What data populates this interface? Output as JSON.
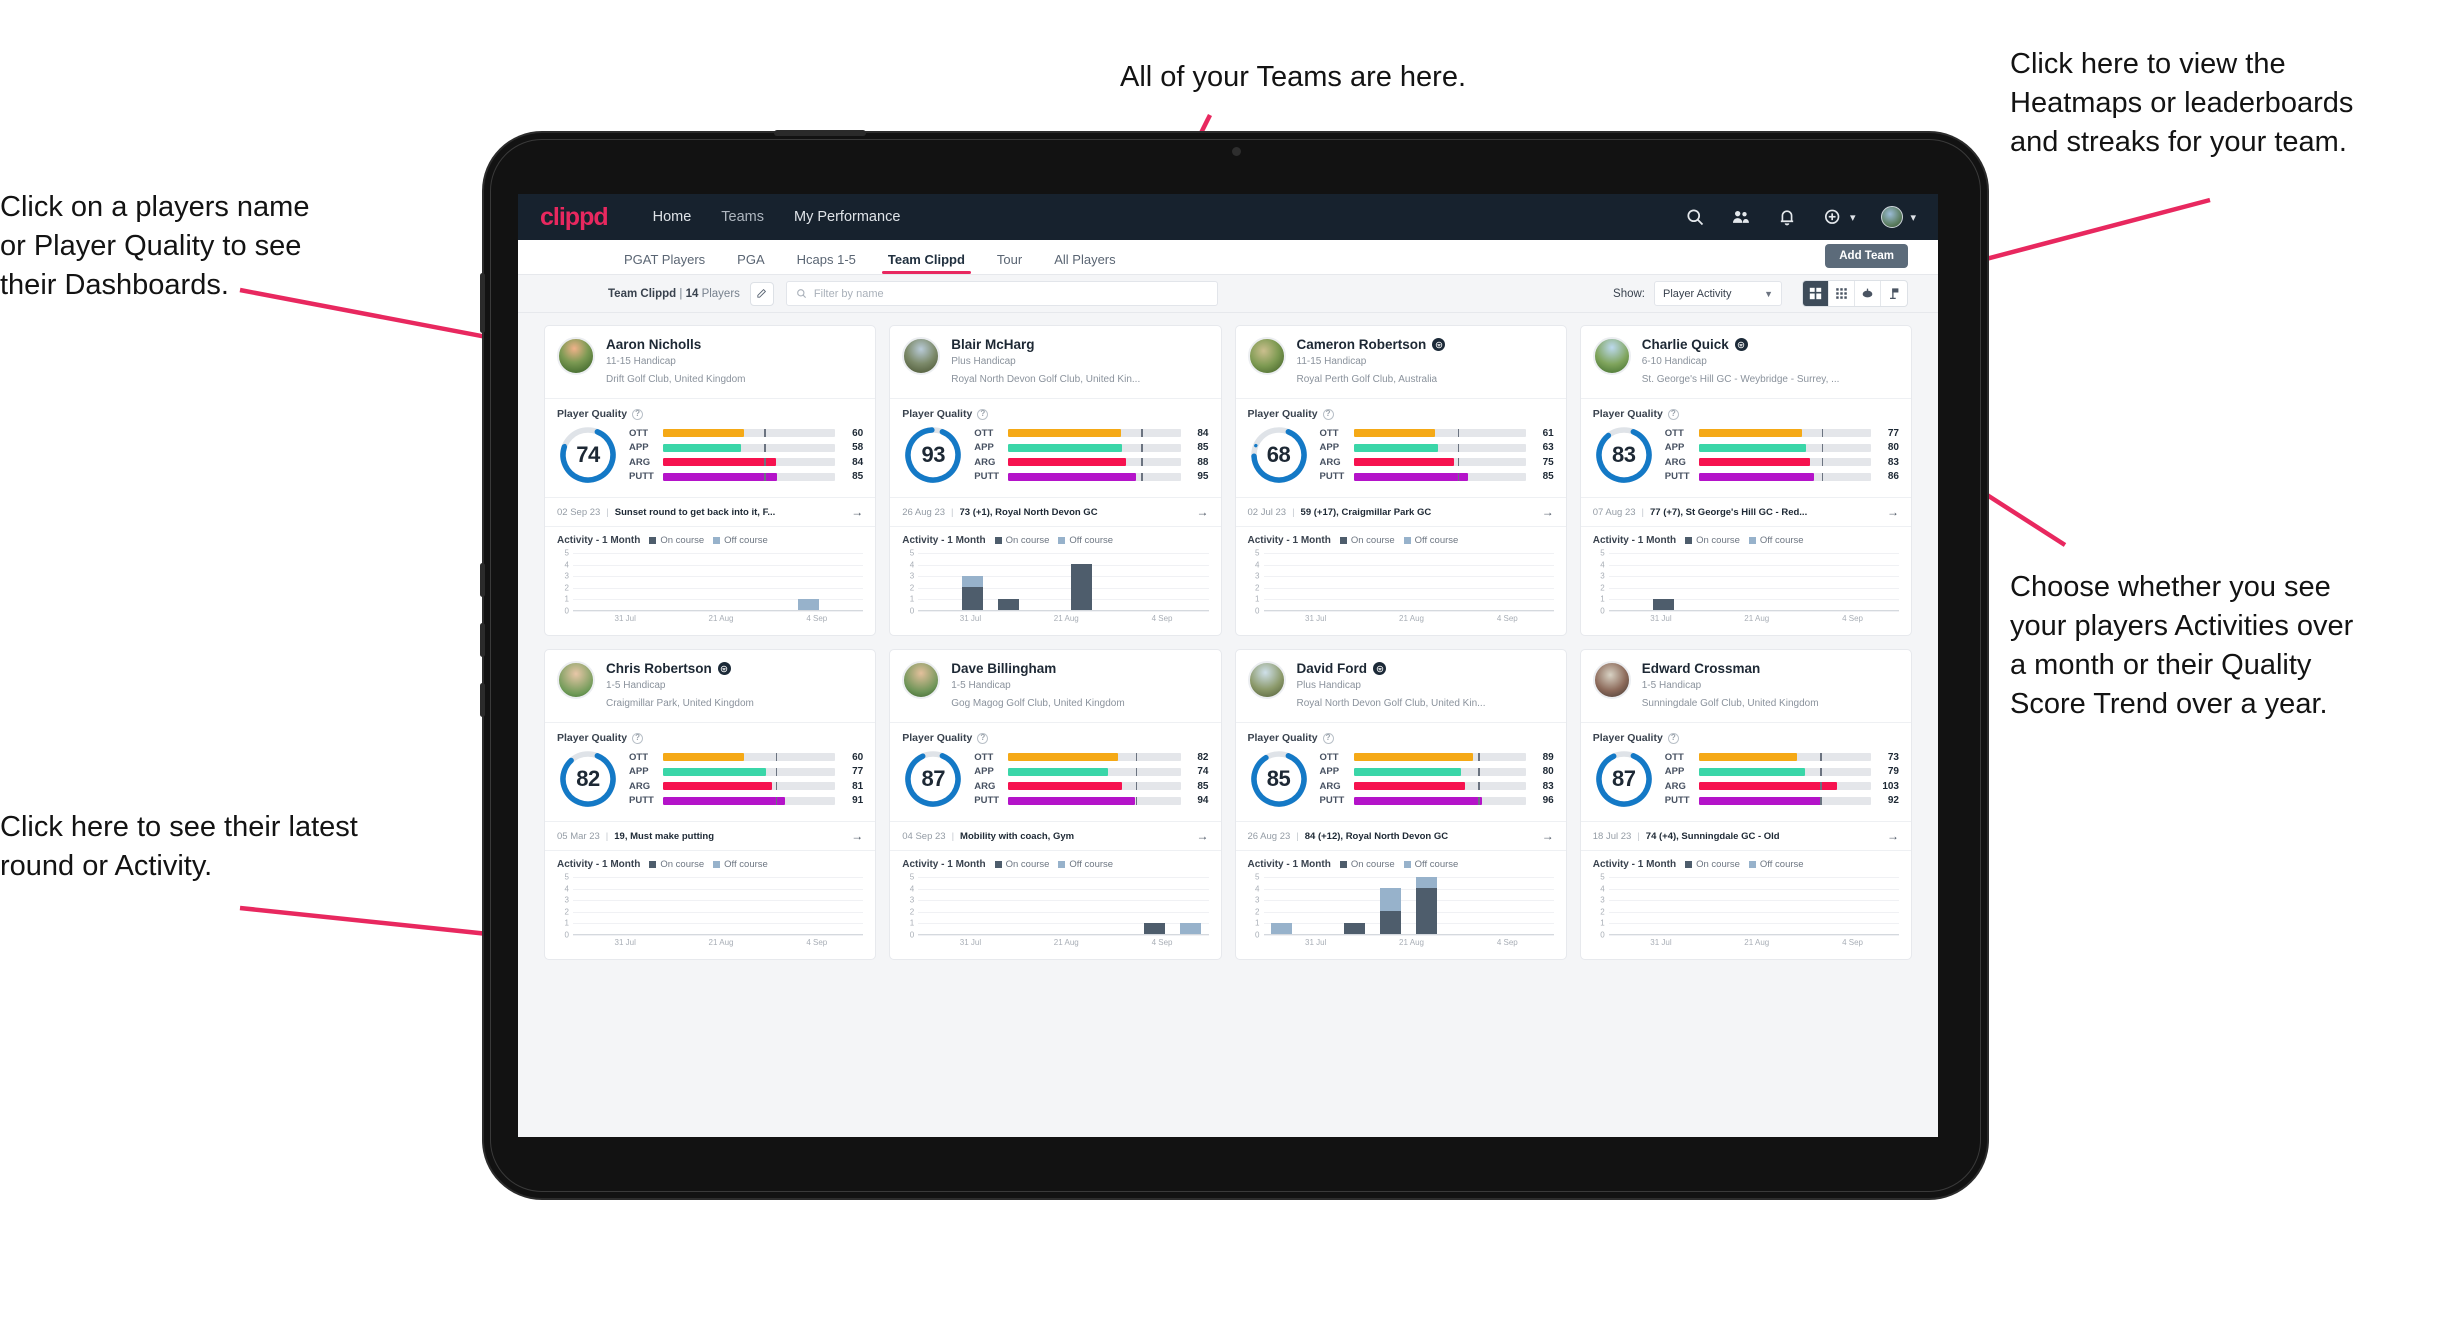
{
  "annotations": [
    {
      "id": "teams-note",
      "text": "All of your Teams are here."
    },
    {
      "id": "heatmaps-note",
      "text": "Click here to view the\nHeatmaps or leaderboards\nand streaks for your team."
    },
    {
      "id": "players-note",
      "text": "Click on a players name\nor Player Quality to see\ntheir Dashboards."
    },
    {
      "id": "activity-choice-note",
      "text": "Choose whether you see\nyour players Activities over\na month or their Quality\nScore Trend over a year."
    },
    {
      "id": "latest-round-note",
      "text": "Click here to see their latest\nround or Activity."
    }
  ],
  "navbar": {
    "logo": "clippd",
    "links": [
      {
        "label": "Home",
        "active": true
      },
      {
        "label": "Teams",
        "active": false
      },
      {
        "label": "My Performance",
        "active": false
      }
    ],
    "icons": [
      "search-icon",
      "people-icon",
      "bell-icon",
      "plus-circle-icon",
      "avatar"
    ]
  },
  "tabs": [
    {
      "label": "PGAT Players",
      "active": false
    },
    {
      "label": "PGA",
      "active": false
    },
    {
      "label": "Hcaps 1-5",
      "active": false
    },
    {
      "label": "Team Clippd",
      "active": true
    },
    {
      "label": "Tour",
      "active": false
    },
    {
      "label": "All Players",
      "active": false
    }
  ],
  "add_team_label": "Add Team",
  "filterbar": {
    "team_name": "Team Clippd",
    "separator": "|",
    "player_count": "14",
    "players_word": "Players",
    "edit_icon": "pencil-icon",
    "search_placeholder": "Filter by name",
    "show_label": "Show:",
    "show_value": "Player Activity",
    "view_buttons": [
      {
        "icon": "grid-cards-icon",
        "active": true
      },
      {
        "icon": "grid-dots-icon",
        "active": false
      },
      {
        "icon": "heatmap-icon",
        "active": false
      },
      {
        "icon": "flag-icon",
        "active": false
      }
    ]
  },
  "card_labels": {
    "player_quality": "Player Quality",
    "activity_title": "Activity - 1 Month",
    "legend_on": "On course",
    "legend_off": "Off course",
    "metrics": [
      "OTT",
      "APP",
      "ARG",
      "PUTT"
    ],
    "x_ticks": [
      "31 Jul",
      "21 Aug",
      "4 Sep"
    ],
    "y_ticks": [
      "5",
      "4",
      "3",
      "2",
      "1",
      "0"
    ],
    "arrow": "→"
  },
  "colors": {
    "brand_pink": "#e8285f",
    "navy": "#17222e",
    "ott": "#f5a916",
    "app": "#3ad6a8",
    "arg": "#f6124f",
    "putt": "#b413c9",
    "ring": "#1479c6",
    "on_course": "#4e5d6c",
    "off_course": "#97b2cb"
  },
  "players": [
    {
      "name": "Aaron Nicholls",
      "verified": false,
      "handicap": "11-15 Handicap",
      "club": "Drift Golf Club, United Kingdom",
      "quality": 74,
      "avatar_css": "radial-gradient(circle at 45% 28%, #f0b28a 0%, #7c9a53 45%, #2f5a22 100%)",
      "metrics": [
        {
          "key": "OTT",
          "value": 60,
          "color": "#f5a916",
          "tick": 70
        },
        {
          "key": "APP",
          "value": 58,
          "color": "#3ad6a8",
          "tick": 70
        },
        {
          "key": "ARG",
          "value": 84,
          "color": "#f6124f",
          "tick": 70
        },
        {
          "key": "PUTT",
          "value": 85,
          "color": "#b413c9",
          "tick": 70
        }
      ],
      "latest": {
        "date": "02 Sep 23",
        "text": "Sunset round to get back into it, F..."
      },
      "chart_data": {
        "type": "bar",
        "title": "Activity - 1 Month",
        "categories": [
          "31 Jul",
          "21 Aug",
          "4 Sep"
        ],
        "ylim": [
          0,
          5
        ],
        "series": [
          {
            "name": "On course",
            "values": [
              0,
              0,
              0,
              0,
              0,
              0,
              0,
              0
            ]
          },
          {
            "name": "Off course",
            "values": [
              0,
              0,
              0,
              0,
              0,
              0,
              1,
              0
            ]
          }
        ]
      }
    },
    {
      "name": "Blair McHarg",
      "verified": false,
      "handicap": "Plus Handicap",
      "club": "Royal North Devon Golf Club, United Kin...",
      "quality": 93,
      "avatar_css": "radial-gradient(circle at 50% 30%, #b9cbd8 0%, #7c8a6a 50%, #46502f 100%)",
      "metrics": [
        {
          "key": "OTT",
          "value": 84,
          "color": "#f5a916",
          "tick": 92
        },
        {
          "key": "APP",
          "value": 85,
          "color": "#3ad6a8",
          "tick": 92
        },
        {
          "key": "ARG",
          "value": 88,
          "color": "#f6124f",
          "tick": 92
        },
        {
          "key": "PUTT",
          "value": 95,
          "color": "#b413c9",
          "tick": 92
        }
      ],
      "latest": {
        "date": "26 Aug 23",
        "text": "73 (+1), Royal North Devon GC"
      },
      "chart_data": {
        "type": "bar",
        "title": "Activity - 1 Month",
        "categories": [
          "31 Jul",
          "21 Aug",
          "4 Sep"
        ],
        "ylim": [
          0,
          5
        ],
        "series": [
          {
            "name": "On course",
            "values": [
              0,
              2,
              1,
              0,
              4,
              0,
              0,
              0
            ]
          },
          {
            "name": "Off course",
            "values": [
              0,
              1,
              0,
              0,
              0,
              0,
              0,
              0
            ]
          }
        ]
      }
    },
    {
      "name": "Cameron Robertson",
      "verified": true,
      "handicap": "11-15 Handicap",
      "club": "Royal Perth Golf Club, Australia",
      "quality": 68,
      "avatar_css": "radial-gradient(circle at 40% 35%, #cbbf8e 0%, #7d9a52 50%, #3b5a24 100%)",
      "metrics": [
        {
          "key": "OTT",
          "value": 61,
          "color": "#f5a916",
          "tick": 72
        },
        {
          "key": "APP",
          "value": 63,
          "color": "#3ad6a8",
          "tick": 72
        },
        {
          "key": "ARG",
          "value": 75,
          "color": "#f6124f",
          "tick": 72
        },
        {
          "key": "PUTT",
          "value": 85,
          "color": "#b413c9",
          "tick": 72
        }
      ],
      "latest": {
        "date": "02 Jul 23",
        "text": "59 (+17), Craigmillar Park GC"
      },
      "chart_data": {
        "type": "bar",
        "title": "Activity - 1 Month",
        "categories": [
          "31 Jul",
          "21 Aug",
          "4 Sep"
        ],
        "ylim": [
          0,
          5
        ],
        "series": [
          {
            "name": "On course",
            "values": [
              0,
              0,
              0,
              0,
              0,
              0,
              0,
              0
            ]
          },
          {
            "name": "Off course",
            "values": [
              0,
              0,
              0,
              0,
              0,
              0,
              0,
              0
            ]
          }
        ]
      }
    },
    {
      "name": "Charlie Quick",
      "verified": true,
      "handicap": "6-10 Handicap",
      "club": "St. George's Hill GC - Weybridge - Surrey, ...",
      "quality": 83,
      "avatar_css": "radial-gradient(circle at 50% 25%, #bcd9ee 0%, #7fa45c 55%, #3e6b2c 100%)",
      "metrics": [
        {
          "key": "OTT",
          "value": 77,
          "color": "#f5a916",
          "tick": 85
        },
        {
          "key": "APP",
          "value": 80,
          "color": "#3ad6a8",
          "tick": 85
        },
        {
          "key": "ARG",
          "value": 83,
          "color": "#f6124f",
          "tick": 85
        },
        {
          "key": "PUTT",
          "value": 86,
          "color": "#b413c9",
          "tick": 85
        }
      ],
      "latest": {
        "date": "07 Aug 23",
        "text": "77 (+7), St George's Hill GC - Red..."
      },
      "chart_data": {
        "type": "bar",
        "title": "Activity - 1 Month",
        "categories": [
          "31 Jul",
          "21 Aug",
          "4 Sep"
        ],
        "ylim": [
          0,
          5
        ],
        "series": [
          {
            "name": "On course",
            "values": [
              0,
              1,
              0,
              0,
              0,
              0,
              0,
              0
            ]
          },
          {
            "name": "Off course",
            "values": [
              0,
              0,
              0,
              0,
              0,
              0,
              0,
              0
            ]
          }
        ]
      }
    },
    {
      "name": "Chris Robertson",
      "verified": true,
      "handicap": "1-5 Handicap",
      "club": "Craigmillar Park, United Kingdom",
      "quality": 82,
      "avatar_css": "radial-gradient(circle at 50% 32%, #e8c7a8 0%, #6f9a57 70%, #3d6a2e 100%)",
      "metrics": [
        {
          "key": "OTT",
          "value": 60,
          "color": "#f5a916",
          "tick": 78
        },
        {
          "key": "APP",
          "value": 77,
          "color": "#3ad6a8",
          "tick": 78
        },
        {
          "key": "ARG",
          "value": 81,
          "color": "#f6124f",
          "tick": 78
        },
        {
          "key": "PUTT",
          "value": 91,
          "color": "#b413c9",
          "tick": 78
        }
      ],
      "latest": {
        "date": "05 Mar 23",
        "text": "19, Must make putting"
      },
      "chart_data": {
        "type": "bar",
        "title": "Activity - 1 Month",
        "categories": [
          "31 Jul",
          "21 Aug",
          "4 Sep"
        ],
        "ylim": [
          0,
          5
        ],
        "series": [
          {
            "name": "On course",
            "values": [
              0,
              0,
              0,
              0,
              0,
              0,
              0,
              0
            ]
          },
          {
            "name": "Off course",
            "values": [
              0,
              0,
              0,
              0,
              0,
              0,
              0,
              0
            ]
          }
        ]
      }
    },
    {
      "name": "Dave Billingham",
      "verified": false,
      "handicap": "1-5 Handicap",
      "club": "Gog Magog Golf Club, United Kingdom",
      "quality": 87,
      "avatar_css": "radial-gradient(circle at 50% 30%, #e3c09c 0%, #6d9457 65%, #3a5f2c 100%)",
      "metrics": [
        {
          "key": "OTT",
          "value": 82,
          "color": "#f5a916",
          "tick": 88
        },
        {
          "key": "APP",
          "value": 74,
          "color": "#3ad6a8",
          "tick": 88
        },
        {
          "key": "ARG",
          "value": 85,
          "color": "#f6124f",
          "tick": 88
        },
        {
          "key": "PUTT",
          "value": 94,
          "color": "#b413c9",
          "tick": 88
        }
      ],
      "latest": {
        "date": "04 Sep 23",
        "text": "Mobility with coach, Gym"
      },
      "chart_data": {
        "type": "bar",
        "title": "Activity - 1 Month",
        "categories": [
          "31 Jul",
          "21 Aug",
          "4 Sep"
        ],
        "ylim": [
          0,
          5
        ],
        "series": [
          {
            "name": "On course",
            "values": [
              0,
              0,
              0,
              0,
              0,
              0,
              1,
              0
            ]
          },
          {
            "name": "Off course",
            "values": [
              0,
              0,
              0,
              0,
              0,
              0,
              0,
              1
            ]
          }
        ]
      }
    },
    {
      "name": "David Ford",
      "verified": true,
      "handicap": "Plus Handicap",
      "club": "Royal North Devon Golf Club, United Kin...",
      "quality": 85,
      "avatar_css": "radial-gradient(circle at 45% 28%, #cfe0ea 0%, #8c9a6b 55%, #4d5a35 100%)",
      "metrics": [
        {
          "key": "OTT",
          "value": 89,
          "color": "#f5a916",
          "tick": 86
        },
        {
          "key": "APP",
          "value": 80,
          "color": "#3ad6a8",
          "tick": 86
        },
        {
          "key": "ARG",
          "value": 83,
          "color": "#f6124f",
          "tick": 86
        },
        {
          "key": "PUTT",
          "value": 96,
          "color": "#b413c9",
          "tick": 86
        }
      ],
      "latest": {
        "date": "26 Aug 23",
        "text": "84 (+12), Royal North Devon GC"
      },
      "chart_data": {
        "type": "bar",
        "title": "Activity - 1 Month",
        "categories": [
          "31 Jul",
          "21 Aug",
          "4 Sep"
        ],
        "ylim": [
          0,
          5
        ],
        "series": [
          {
            "name": "On course",
            "values": [
              0,
              0,
              1,
              2,
              4,
              0,
              0,
              0
            ]
          },
          {
            "name": "Off course",
            "values": [
              1,
              0,
              0,
              2,
              1,
              0,
              0,
              0
            ]
          }
        ]
      }
    },
    {
      "name": "Edward Crossman",
      "verified": false,
      "handicap": "1-5 Handicap",
      "club": "Sunningdale Golf Club, United Kingdom",
      "quality": 87,
      "avatar_css": "radial-gradient(circle at 45% 35%, #d8d2c4 0%, #8c6a5a 55%, #3d3530 100%)",
      "metrics": [
        {
          "key": "OTT",
          "value": 73,
          "color": "#f5a916",
          "tick": 84
        },
        {
          "key": "APP",
          "value": 79,
          "color": "#3ad6a8",
          "tick": 84
        },
        {
          "key": "ARG",
          "value": 103,
          "color": "#f6124f",
          "tick": 84
        },
        {
          "key": "PUTT",
          "value": 92,
          "color": "#b413c9",
          "tick": 84
        }
      ],
      "latest": {
        "date": "18 Jul 23",
        "text": "74 (+4), Sunningdale GC - Old"
      },
      "chart_data": {
        "type": "bar",
        "title": "Activity - 1 Month",
        "categories": [
          "31 Jul",
          "21 Aug",
          "4 Sep"
        ],
        "ylim": [
          0,
          5
        ],
        "series": [
          {
            "name": "On course",
            "values": [
              0,
              0,
              0,
              0,
              0,
              0,
              0,
              0
            ]
          },
          {
            "name": "Off course",
            "values": [
              0,
              0,
              0,
              0,
              0,
              0,
              0,
              0
            ]
          }
        ]
      }
    }
  ]
}
